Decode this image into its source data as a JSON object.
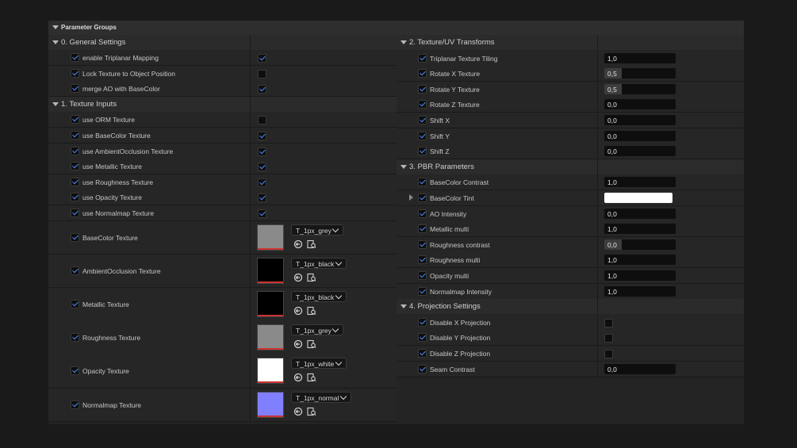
{
  "header": {
    "title": "Parameter Groups"
  },
  "left": {
    "general": {
      "title": "0. General Settings",
      "rows": [
        {
          "label": "enable Triplanar Mapping",
          "value": true
        },
        {
          "label": "Lock Texture to Object Position",
          "value": false
        },
        {
          "label": "merge AO with BaseColor",
          "value": true
        }
      ]
    },
    "textureInputs": {
      "title": "1. Texture Inputs",
      "rows": [
        {
          "label": "use ORM Texture",
          "value": false
        },
        {
          "label": "use BaseColor Texture",
          "value": true
        },
        {
          "label": "use AmbientOcclusion Texture",
          "value": true
        },
        {
          "label": "use Metallic Texture",
          "value": true
        },
        {
          "label": "use Roughness Texture",
          "value": true
        },
        {
          "label": "use Opacity Texture",
          "value": true
        },
        {
          "label": "use Normalmap Texture",
          "value": true
        }
      ]
    },
    "textures": [
      {
        "label": "BaseColor Texture",
        "asset": "T_1px_grey",
        "color": "#8a8a8a"
      },
      {
        "label": "AmbientOcclusion Texture",
        "asset": "T_1px_black",
        "color": "#000000"
      },
      {
        "label": "Metallic Texture",
        "asset": "T_1px_black",
        "color": "#000000"
      },
      {
        "label": "Roughness Texture",
        "asset": "T_1px_grey",
        "color": "#8a8a8a"
      },
      {
        "label": "Opacity Texture",
        "asset": "T_1px_white",
        "color": "#ffffff"
      },
      {
        "label": "Normalmap Texture",
        "asset": "T_1px_normal",
        "color": "#8080ff"
      }
    ]
  },
  "right": {
    "transforms": {
      "title": "2. Texture/UV Transforms",
      "rows": [
        {
          "label": "Triplanar Texture Tiling",
          "value": "1,0",
          "fill": 0
        },
        {
          "label": "Rotate X Texture",
          "value": "0,5",
          "fill": 0.5
        },
        {
          "label": "Rotate Y Texture",
          "value": "0,5",
          "fill": 0.5
        },
        {
          "label": "Rotate Z Texture",
          "value": "0,0",
          "fill": 0
        },
        {
          "label": "Shift X",
          "value": "0,0",
          "fill": 0
        },
        {
          "label": "Shift Y",
          "value": "0,0",
          "fill": 0
        },
        {
          "label": "Shift Z",
          "value": "0,0",
          "fill": 0
        }
      ]
    },
    "pbr": {
      "title": "3. PBR Parameters",
      "rows": [
        {
          "label": "BaseColor Contrast",
          "value": "1,0",
          "fill": 0,
          "kind": "num"
        },
        {
          "label": "BaseColor Tint",
          "value": "",
          "fill": 0,
          "kind": "color",
          "color": "#ffffff"
        },
        {
          "label": "AO Intensity",
          "value": "0,0",
          "fill": 0,
          "kind": "num"
        },
        {
          "label": "Metallic multi",
          "value": "1,0",
          "fill": 0,
          "kind": "num"
        },
        {
          "label": "Roughness contrast",
          "value": "0,0",
          "fill": 0.5,
          "kind": "num"
        },
        {
          "label": "Roughness multi",
          "value": "1,0",
          "fill": 0,
          "kind": "num"
        },
        {
          "label": "Opacity multi",
          "value": "1,0",
          "fill": 0,
          "kind": "num"
        },
        {
          "label": "Normalmap Intensity",
          "value": "1,0",
          "fill": 0,
          "kind": "num"
        }
      ]
    },
    "projection": {
      "title": "4. Projection Settings",
      "rows": [
        {
          "label": "Disable X Projection",
          "kind": "bool",
          "value": false
        },
        {
          "label": "Disable Y Projection",
          "kind": "bool",
          "value": false
        },
        {
          "label": "Disable Z Projection",
          "kind": "bool",
          "value": false
        },
        {
          "label": "Seam Contrast",
          "kind": "num",
          "value": "0,0",
          "fill": 0
        }
      ]
    }
  },
  "colors": {
    "accent": "#4a8cff",
    "panel": "#242424",
    "background": "#1a1a1a"
  }
}
